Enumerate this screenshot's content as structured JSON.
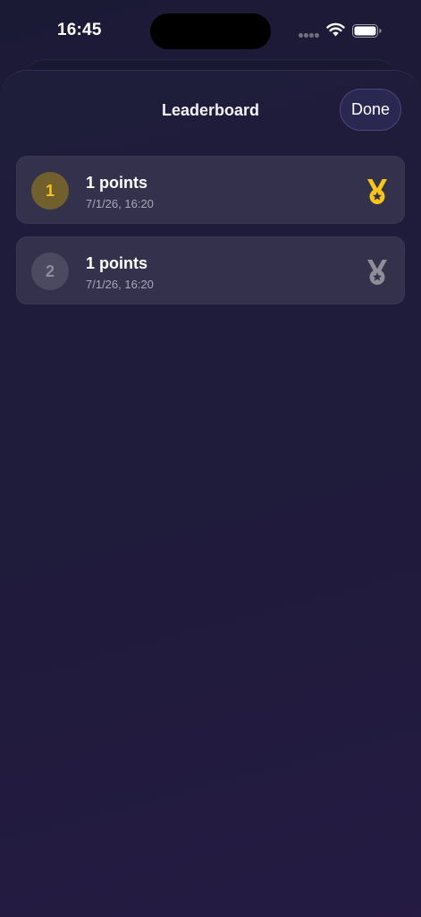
{
  "status_bar": {
    "time": "16:45"
  },
  "header": {
    "title": "Leaderboard",
    "done_label": "Done"
  },
  "leaderboard": [
    {
      "rank": "1",
      "points": "1 points",
      "date": "7/1/26, 16:20",
      "medal": "gold-medal-icon",
      "badge_bg": "#71602d",
      "badge_fg": "#f5c518",
      "medal_color": "#f5c518"
    },
    {
      "rank": "2",
      "points": "1 points",
      "date": "7/1/26, 16:20",
      "medal": "silver-medal-icon",
      "badge_bg": "#4b4a5e",
      "badge_fg": "#8e8d9a",
      "medal_color": "#8e8d98"
    }
  ]
}
